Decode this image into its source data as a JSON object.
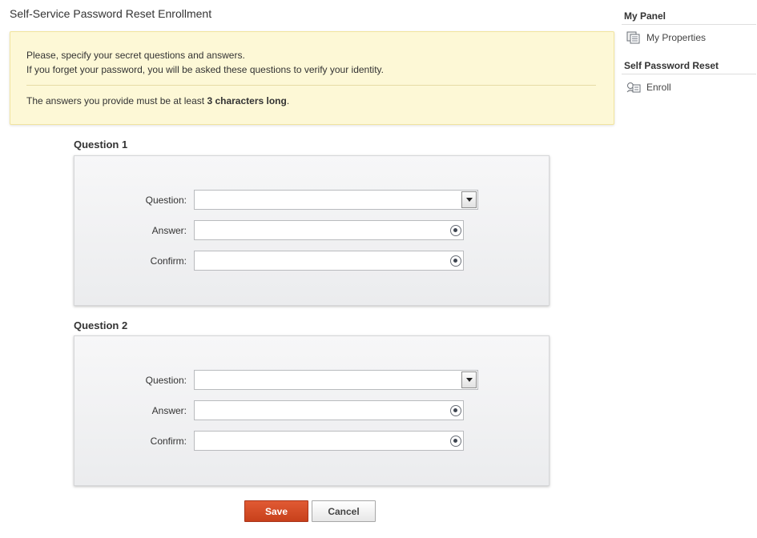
{
  "page": {
    "title": "Self-Service Password Reset Enrollment"
  },
  "info": {
    "line1": "Please, specify your secret questions and answers.",
    "line2": "If you forget your password, you will be asked these questions to verify your identity.",
    "line3_prefix": "The answers you provide must be at least ",
    "line3_bold": "3 characters long",
    "line3_suffix": "."
  },
  "questions": [
    {
      "heading": "Question 1",
      "question_label": "Question:",
      "question_value": "",
      "answer_label": "Answer:",
      "answer_value": "",
      "confirm_label": "Confirm:",
      "confirm_value": ""
    },
    {
      "heading": "Question 2",
      "question_label": "Question:",
      "question_value": "",
      "answer_label": "Answer:",
      "answer_value": "",
      "confirm_label": "Confirm:",
      "confirm_value": ""
    }
  ],
  "actions": {
    "save_label": "Save",
    "cancel_label": "Cancel"
  },
  "sidebar": {
    "sections": [
      {
        "heading": "My Panel",
        "items": [
          {
            "label": "My Properties",
            "icon": "properties-icon"
          }
        ]
      },
      {
        "heading": "Self Password Reset",
        "items": [
          {
            "label": "Enroll",
            "icon": "enroll-icon"
          }
        ]
      }
    ]
  },
  "colors": {
    "save_button": "#d24a26",
    "info_background": "#fdf8d6"
  }
}
